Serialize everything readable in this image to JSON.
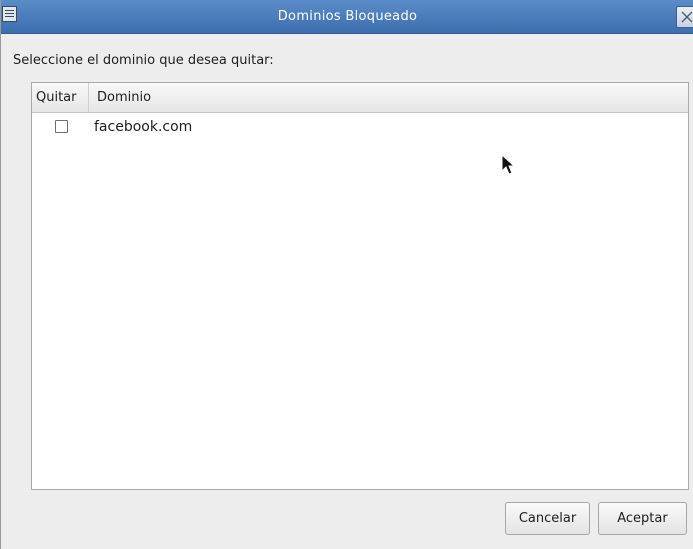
{
  "window": {
    "title": "Dominios Bloqueado"
  },
  "icons": {
    "window_menu": "window-menu-icon",
    "close": "close-icon",
    "cursor": "mouse-pointer-icon"
  },
  "colors": {
    "titlebar": "#4a7fc0",
    "background": "#ededed"
  },
  "dialog": {
    "prompt": "Seleccione el dominio que desea quitar:"
  },
  "table": {
    "columns": [
      "Quitar",
      "Dominio"
    ],
    "rows": [
      {
        "quitar": false,
        "dominio": "facebook.com"
      }
    ]
  },
  "buttons": {
    "cancel": "Cancelar",
    "accept": "Aceptar"
  }
}
